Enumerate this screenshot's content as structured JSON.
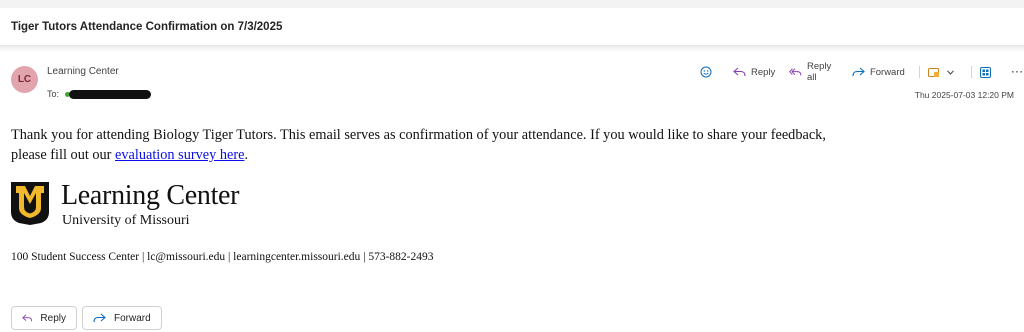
{
  "email": {
    "subject": "Tiger Tutors Attendance Confirmation on 7/3/2025",
    "sender": {
      "initials": "LC",
      "name": "Learning Center",
      "avatar_color": "#e3a5ad"
    },
    "to_label": "To:",
    "timestamp": "Thu 2025-07-03 12:20 PM",
    "body": {
      "line1": "Thank you for attending Biology Tiger Tutors. This email serves as confirmation of your attendance. If you would like to share your feedback,",
      "line2_prefix": "please fill out our ",
      "link_text": "evaluation survey here",
      "line2_suffix": "."
    },
    "signature": {
      "title": "Learning Center",
      "subtitle": "University of Missouri",
      "footer": "100 Student Success Center | lc@missouri.edu | learningcenter.missouri.edu | 573-882-2493",
      "logo_colors": {
        "black": "#111111",
        "gold": "#f1b82d"
      }
    }
  },
  "toolbar": {
    "reply_label": "Reply",
    "reply_all_label": "Reply all",
    "forward_label": "Forward",
    "more_label": "···"
  },
  "bottom_actions": {
    "reply_label": "Reply",
    "forward_label": "Forward"
  },
  "colors": {
    "link": "#0b0ee8",
    "icon_blue": "#0f6cbd",
    "reply_all_purple": "#8a3fb7",
    "presence_green": "#41a62a"
  }
}
